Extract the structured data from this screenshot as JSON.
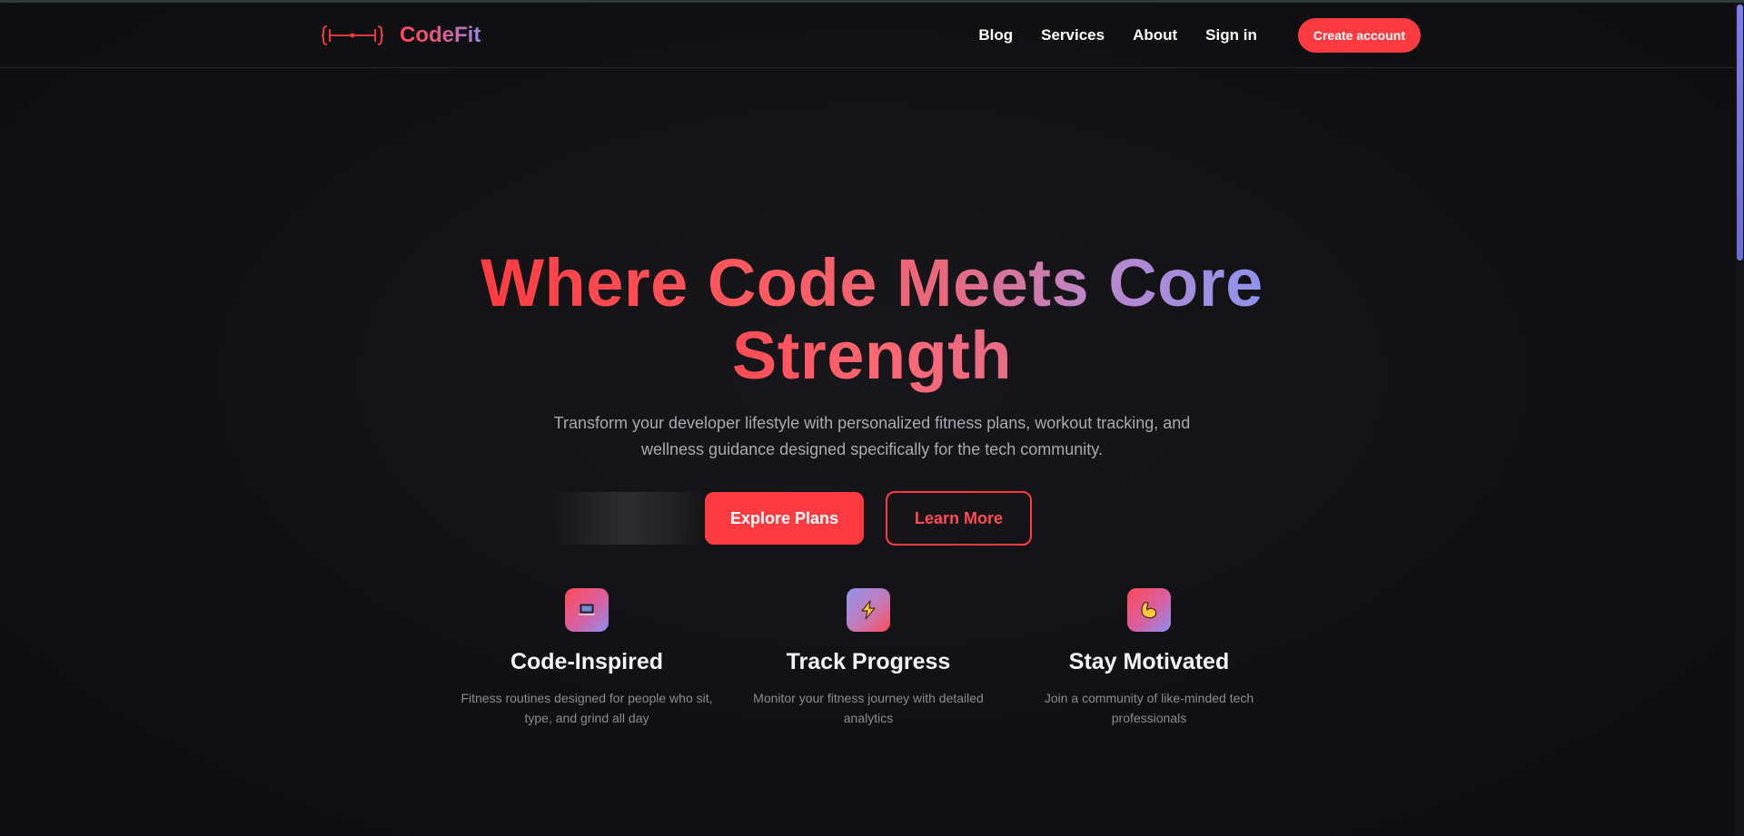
{
  "brand": {
    "name": "CodeFit",
    "logo_icon": "dumbbell-brackets-icon"
  },
  "nav": {
    "links": [
      "Blog",
      "Services",
      "About",
      "Sign in"
    ],
    "cta": "Create account"
  },
  "hero": {
    "title_line1": "Where Code Meets Core",
    "title_line2": "Strength",
    "subtitle_line1": "Transform your developer lifestyle with personalized fitness plans, workout tracking, and",
    "subtitle_line2": "wellness guidance designed specifically for the tech community.",
    "primary_button": "Explore Plans",
    "secondary_button": "Learn More"
  },
  "features": [
    {
      "icon": "laptop-icon",
      "title": "Code-Inspired",
      "desc_line1": "Fitness routines designed for people who sit,",
      "desc_line2": "type, and grind all day"
    },
    {
      "icon": "lightning-icon",
      "title": "Track Progress",
      "desc_line1": "Monitor your fitness journey with detailed",
      "desc_line2": "analytics"
    },
    {
      "icon": "flexed-biceps-icon",
      "title": "Stay Motivated",
      "desc_line1": "Join a community of like-minded tech",
      "desc_line2": "professionals"
    }
  ],
  "colors": {
    "accent": "#ff3b42",
    "accent_purple": "#8f93ee",
    "background": "#111114"
  }
}
